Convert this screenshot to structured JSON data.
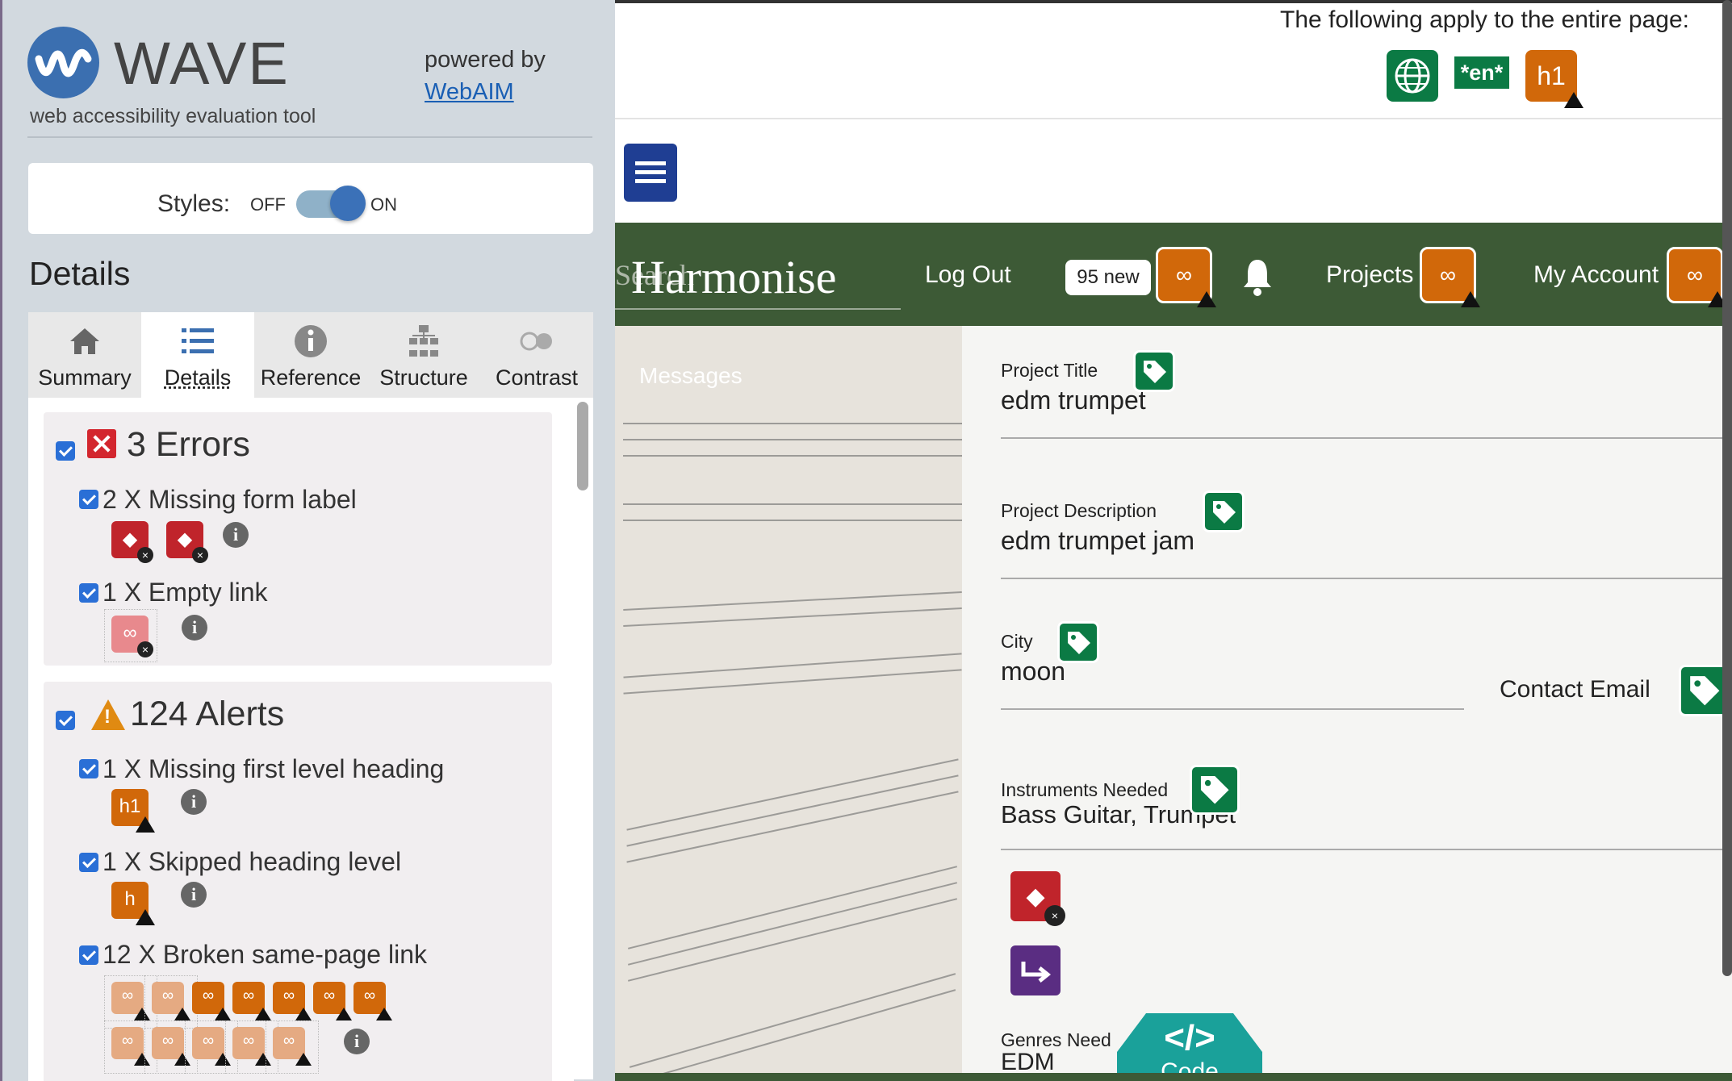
{
  "wave": {
    "logo_word": "WAVE",
    "subtitle": "web accessibility evaluation tool",
    "powered_by": "powered by",
    "webaim_link": "WebAIM",
    "styles": {
      "label": "Styles:",
      "off": "OFF",
      "on": "ON",
      "state": "on"
    },
    "details_heading": "Details",
    "tabs": [
      {
        "label": "Summary",
        "icon": "home-icon",
        "active": false
      },
      {
        "label": "Details",
        "icon": "list-icon",
        "active": true
      },
      {
        "label": "Reference",
        "icon": "info-icon",
        "active": false
      },
      {
        "label": "Structure",
        "icon": "structure-icon",
        "active": false
      },
      {
        "label": "Contrast",
        "icon": "contrast-icon",
        "active": false
      }
    ],
    "errors": {
      "title": "3 Errors",
      "items": [
        {
          "text": "2 X Missing form label",
          "icon_count": 2
        },
        {
          "text": "1 X Empty link",
          "icon_count": 1
        }
      ]
    },
    "alerts": {
      "title": "124 Alerts",
      "items": [
        {
          "text": "1 X Missing first level heading",
          "icon_glyph": "h1"
        },
        {
          "text": "1 X Skipped heading level",
          "icon_glyph": "h"
        },
        {
          "text": "12 X Broken same-page link",
          "icon_count": 12
        }
      ]
    }
  },
  "page": {
    "apply_text": "The following apply to the entire page:",
    "lang_badge": "*en*",
    "h1_badge": "h1",
    "nav": {
      "search_ghost": "Search",
      "brand": "Harmonise",
      "logout": "Log Out",
      "new_pill": "95 new",
      "projects": "Projects",
      "account": "My Account"
    },
    "messages_link": "Messages",
    "fields": {
      "title_label": "Project Title",
      "title_value": "edm trumpet",
      "desc_label": "Project Description",
      "desc_value": "edm trumpet jam",
      "city_label": "City",
      "city_value": "moon",
      "email_label": "Contact Email",
      "instr_label": "Instruments Needed",
      "instr_value": "Bass Guitar, Trumpet",
      "genres_label": "Genres Need",
      "genres_value": "EDM"
    },
    "code_button": {
      "symbol": "</>",
      "label": "Code"
    }
  },
  "colors": {
    "navbar": "#3d5a36",
    "wave_panel": "#d2d9df",
    "error": "#c0242b",
    "alert": "#d1680a",
    "feature": "#0b7a44",
    "code": "#1aa19a"
  }
}
